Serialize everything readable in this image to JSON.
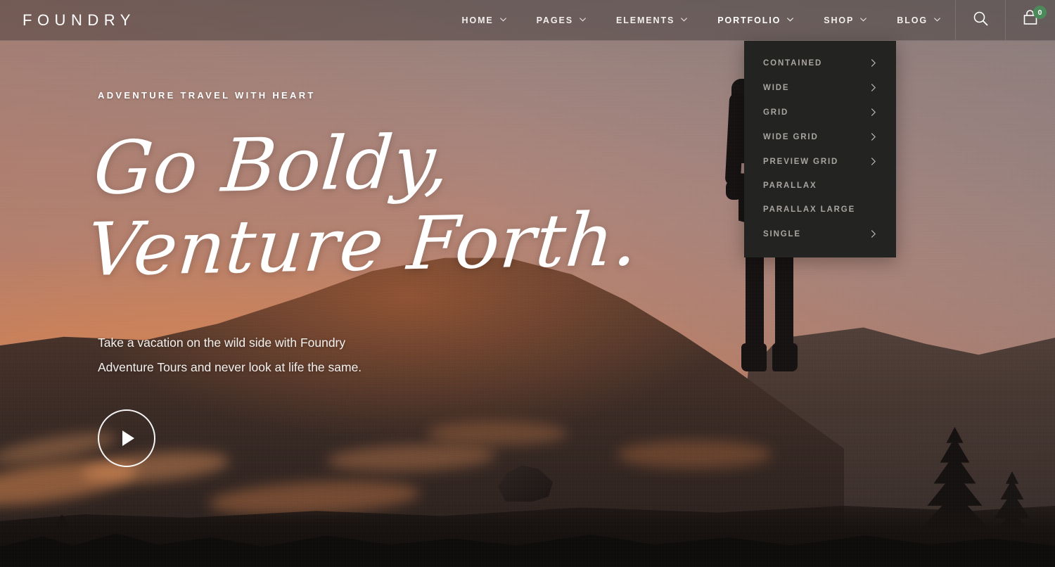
{
  "brand": {
    "name": "FOUNDRY"
  },
  "header": {
    "nav": [
      {
        "label": "HOME",
        "has_dropdown": true,
        "open": false
      },
      {
        "label": "PAGES",
        "has_dropdown": true,
        "open": false
      },
      {
        "label": "ELEMENTS",
        "has_dropdown": true,
        "open": false
      },
      {
        "label": "PORTFOLIO",
        "has_dropdown": true,
        "open": true
      },
      {
        "label": "SHOP",
        "has_dropdown": true,
        "open": false
      },
      {
        "label": "BLOG",
        "has_dropdown": true,
        "open": false
      }
    ],
    "search_icon": "search-icon",
    "cart_icon": "shopping-cart-icon",
    "cart_count": "0",
    "cart_badge_color": "#4c8a5c"
  },
  "dropdown": {
    "parent": "PORTFOLIO",
    "items": [
      {
        "label": "CONTAINED",
        "has_submenu": true
      },
      {
        "label": "WIDE",
        "has_submenu": true
      },
      {
        "label": "GRID",
        "has_submenu": true
      },
      {
        "label": "WIDE GRID",
        "has_submenu": true
      },
      {
        "label": "PREVIEW GRID",
        "has_submenu": true
      },
      {
        "label": "PARALLAX",
        "has_submenu": false
      },
      {
        "label": "PARALLAX LARGE",
        "has_submenu": false
      },
      {
        "label": "SINGLE",
        "has_submenu": true
      }
    ]
  },
  "hero": {
    "eyebrow": "ADVENTURE TRAVEL WITH HEART",
    "headline_line1": "Go Boldy,",
    "headline_line2": "Venture Forth.",
    "lede_line1": "Take a vacation on the wild side with Foundry",
    "lede_line2": "Adventure Tours and never look at life the same.",
    "play_button_icon": "play-icon",
    "background": "sunset-mountain-hiker-photo"
  },
  "colors": {
    "text_light": "#ffffff",
    "dropdown_bg": "#232322",
    "dropdown_text": "#a9a5a0",
    "header_bg": "rgba(52,48,47,0.42)",
    "accent_green": "#4c8a5c",
    "sunset_orange": "#c87a5e"
  }
}
